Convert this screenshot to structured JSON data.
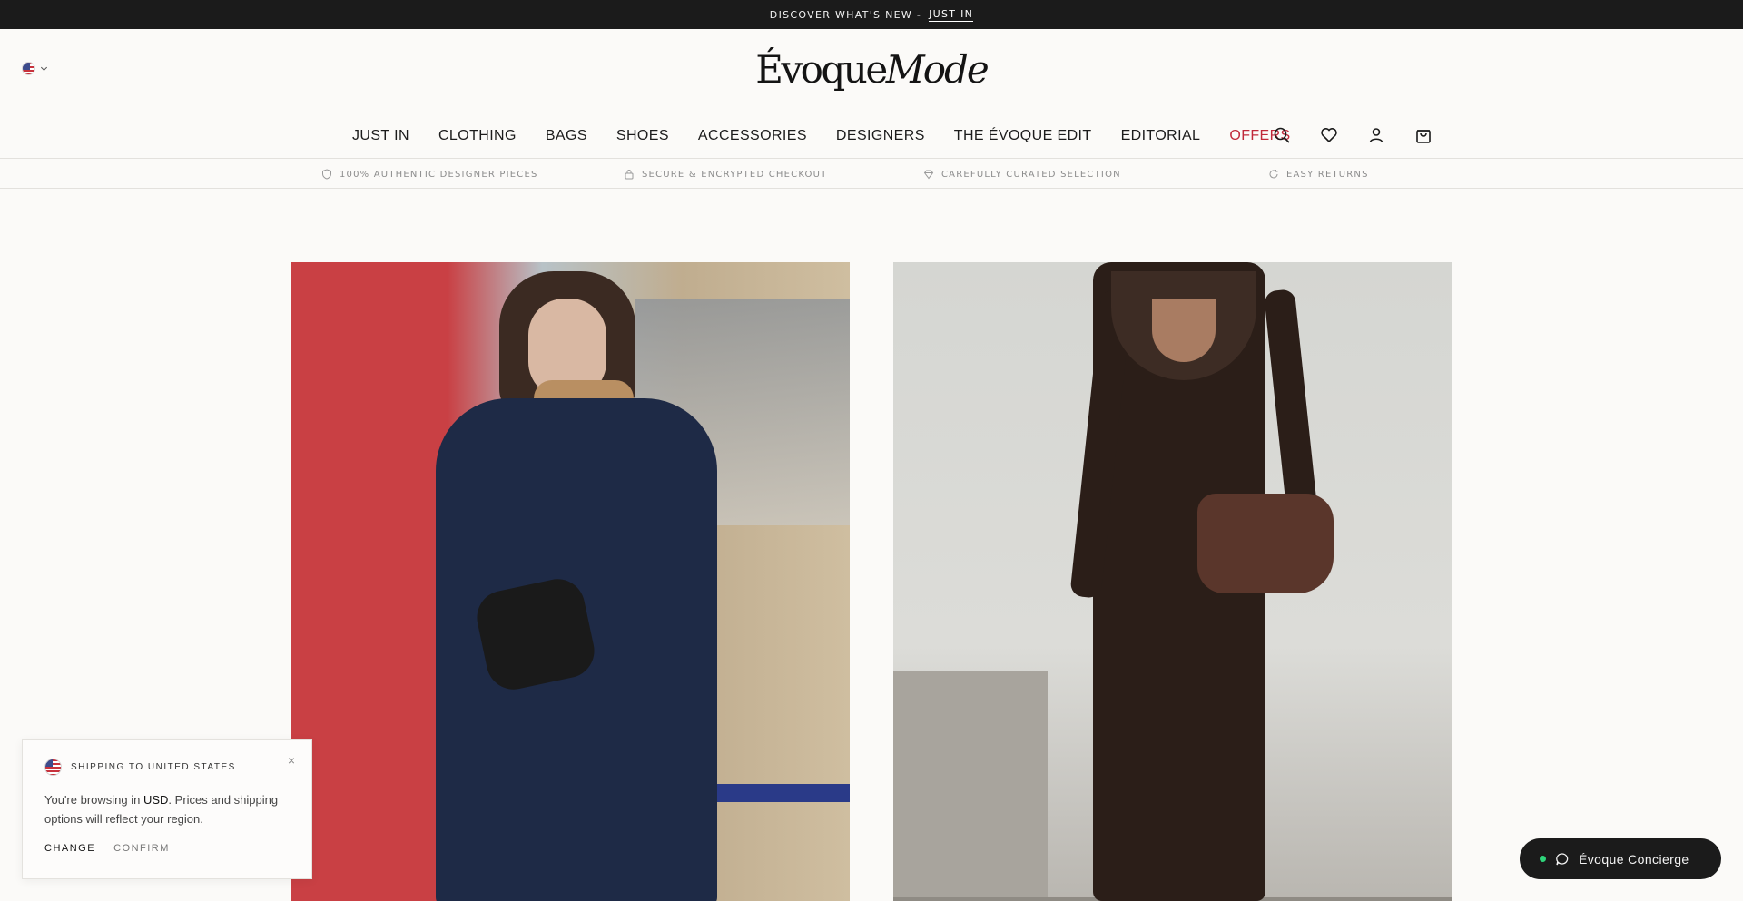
{
  "announcement": {
    "text": "DISCOVER WHAT'S NEW -",
    "link_label": "JUST IN"
  },
  "header": {
    "logo_part1": "Évoque",
    "logo_part2": "Mode",
    "locale_icon": "us-flag-icon"
  },
  "nav": {
    "items": [
      {
        "label": "JUST IN"
      },
      {
        "label": "CLOTHING"
      },
      {
        "label": "BAGS"
      },
      {
        "label": "SHOES"
      },
      {
        "label": "ACCESSORIES"
      },
      {
        "label": "DESIGNERS"
      },
      {
        "label": "THE ÉVOQUE EDIT"
      },
      {
        "label": "EDITORIAL"
      },
      {
        "label": "OFFERS",
        "color": "#c0293a"
      }
    ],
    "icons": [
      "search-icon",
      "heart-icon",
      "user-icon",
      "bag-icon"
    ]
  },
  "trust_bar": {
    "items": [
      {
        "icon": "shield-icon",
        "label": "100% AUTHENTIC DESIGNER PIECES"
      },
      {
        "icon": "lock-icon",
        "label": "SECURE & ENCRYPTED CHECKOUT"
      },
      {
        "icon": "diamond-icon",
        "label": "CAREFULLY CURATED SELECTION"
      },
      {
        "icon": "refresh-icon",
        "label": "EASY RETURNS"
      }
    ]
  },
  "shipping_popup": {
    "title": "SHIPPING TO UNITED STATES",
    "message_prefix": "You're browsing in ",
    "currency": "USD",
    "message_suffix": ". Prices and shipping options will reflect your region.",
    "change_label": "CHANGE",
    "confirm_label": "CONFIRM",
    "close_glyph": "×"
  },
  "concierge": {
    "label": "Évoque Concierge",
    "status_color": "#2ed47a"
  },
  "colors": {
    "accent_offers": "#c0293a",
    "dark_bar": "#1b1b1b",
    "background": "#fbfaf8"
  }
}
